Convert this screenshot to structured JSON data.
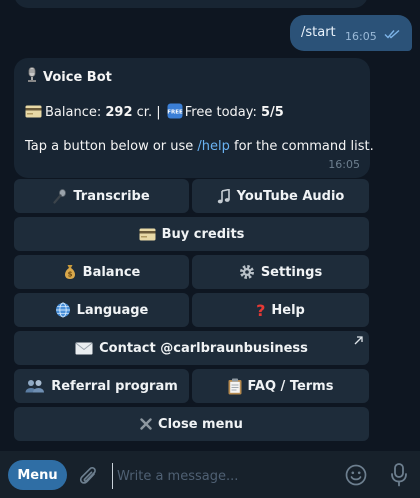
{
  "outgoing": {
    "text": "/start",
    "time": "16:05"
  },
  "bot_message": {
    "title": "Voice Bot",
    "balance_label": "Balance:",
    "balance_value": "292",
    "balance_unit": "cr. |",
    "free_label": "Free today:",
    "free_value": "5/5",
    "hint_before": "Tap a button below or use ",
    "hint_link": "/help",
    "hint_after": " for the command list.",
    "time": "16:05"
  },
  "keyboard": {
    "transcribe": "Transcribe",
    "youtube_audio": "YouTube Audio",
    "buy_credits": "Buy credits",
    "balance": "Balance",
    "settings": "Settings",
    "language": "Language",
    "help": "Help",
    "contact": "Contact @carlbraunbusiness",
    "referral": "Referral program",
    "faq": "FAQ / Terms",
    "close_menu": "Close menu"
  },
  "input": {
    "menu_label": "Menu",
    "placeholder": "Write a message..."
  },
  "colors": {
    "background": "#0e1621",
    "bubble_in": "#182533",
    "bubble_out": "#2b5278",
    "keyboard_button": "#1e2c3a",
    "menu_button": "#2f6ea5",
    "link": "#6ab3f3"
  },
  "icons": {
    "bot_title": "studio-microphone-icon",
    "balance": "credit-card-icon",
    "free": "free-badge-icon",
    "transcribe": "microphone-icon",
    "youtube_audio": "music-note-icon",
    "buy_credits": "credit-card-icon",
    "balance_button": "money-bag-icon",
    "settings": "gear-icon",
    "language": "globe-icon",
    "help": "question-mark-icon",
    "contact": "envelope-icon",
    "referral": "people-icon",
    "faq": "clipboard-icon",
    "close_menu": "close-icon",
    "attach": "paperclip-icon",
    "emoji": "smiley-icon",
    "voice": "microphone-icon"
  }
}
